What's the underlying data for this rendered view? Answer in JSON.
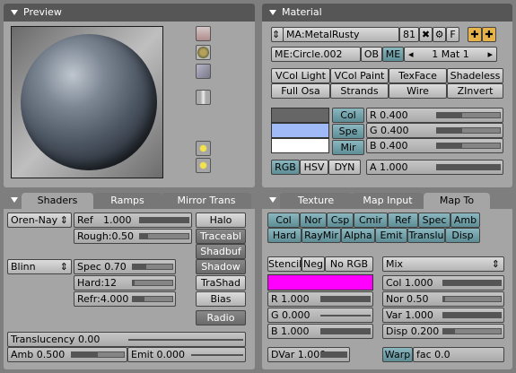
{
  "preview": {
    "title": "Preview"
  },
  "material": {
    "title": "Material",
    "name": "MA:MetalRusty",
    "users": "81",
    "x": "✖",
    "f": "F",
    "mesh": "ME:Circle.002",
    "ob": "OB",
    "me": "ME",
    "mat_index": "1 Mat 1",
    "mode_buttons": [
      [
        "VCol Light",
        "VCol Paint",
        "TexFace",
        "Shadeless"
      ],
      [
        "Full Osa",
        "Strands",
        "Wire",
        "ZInvert"
      ]
    ],
    "color_tabs": [
      "Col",
      "Spe",
      "Mir"
    ],
    "col_value": 0.4,
    "spe_value": 0.75,
    "mir_value": 1.0,
    "rgb_sliders": [
      {
        "label": "R 0.400",
        "value": 0.4
      },
      {
        "label": "G 0.400",
        "value": 0.4
      },
      {
        "label": "B 0.400",
        "value": 0.4
      }
    ],
    "color_modes": [
      "RGB",
      "HSV",
      "DYN"
    ],
    "alpha": {
      "label": "A 1.000",
      "value": 1.0
    },
    "colors": {
      "col": "#666666",
      "spe": "#a0b9f7",
      "mir": "#ffffff"
    }
  },
  "shaders": {
    "tabs": [
      "Shaders",
      "Ramps",
      "Mirror Trans"
    ],
    "diffuse": "Oren-Nay",
    "ref": {
      "label": "Ref",
      "value": "1.000",
      "fill": 1.0
    },
    "rough": {
      "label": "Rough:0.50",
      "fill": 0.16
    },
    "specular": "Blinn",
    "spec": {
      "label": "Spec 0.70",
      "fill": 0.35
    },
    "hard": {
      "label": "Hard:12",
      "fill": 0.05
    },
    "refr": {
      "label": "Refr:4.000",
      "fill": 0.3
    },
    "side_buttons": [
      "Halo",
      "Traceabl",
      "Shadbuf",
      "Shadow",
      "TraShad",
      "Bias",
      "Radio"
    ],
    "translucency": {
      "label": "Translucency 0.00",
      "fill": 0.0
    },
    "amb": {
      "label": "Amb 0.500",
      "fill": 0.5
    },
    "emit": {
      "label": "Emit 0.000",
      "fill": 0.0
    }
  },
  "texture": {
    "tabs": [
      "Texture",
      "Map Input",
      "Map To"
    ],
    "mapto_row1": [
      "Col",
      "Nor",
      "Csp",
      "Cmir",
      "Ref",
      "Spec",
      "Amb"
    ],
    "mapto_row2": [
      "Hard",
      "RayMir",
      "Alpha",
      "Emit",
      "Translu",
      "Disp"
    ],
    "stencil": "Stencil",
    "neg": "Neg",
    "norgb": "No RGB",
    "blend": "Mix",
    "tex_color": "#ff00ff",
    "rgb": [
      {
        "label": "R 1.000",
        "fill": 1.0
      },
      {
        "label": "G 0.000",
        "fill": 0.0
      },
      {
        "label": "B 1.000",
        "fill": 1.0
      }
    ],
    "dvar": {
      "label": "DVar 1.000",
      "fill": 1.0
    },
    "factors": [
      {
        "label": "Col 1.000",
        "fill": 1.0
      },
      {
        "label": "Nor 0.50",
        "fill": 0.02
      },
      {
        "label": "Var 1.000",
        "fill": 1.0
      },
      {
        "label": "Disp 0.200",
        "fill": 0.2
      }
    ],
    "warp": "Warp",
    "warp_fac": "fac 0.0"
  }
}
